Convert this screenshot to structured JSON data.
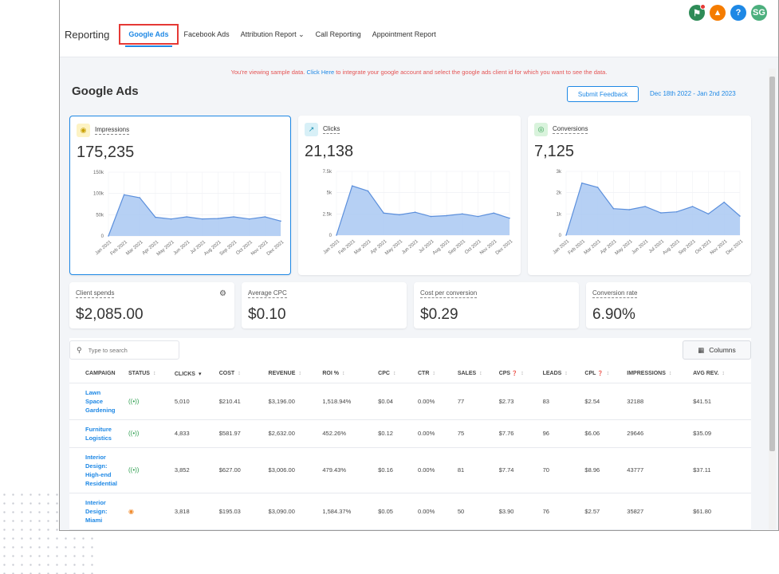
{
  "topbar": {
    "icons": [
      {
        "name": "megaphone-icon",
        "color": "#2e8b57",
        "glyph": "⚑"
      },
      {
        "name": "bell-icon",
        "color": "#f57c00",
        "glyph": "▲"
      },
      {
        "name": "help-icon",
        "color": "#1e88e5",
        "glyph": "?"
      },
      {
        "name": "user-avatar",
        "color": "#4caf7d",
        "glyph": "SG"
      }
    ]
  },
  "nav": {
    "brand": "Reporting",
    "tabs": [
      {
        "label": "Google Ads",
        "active": true
      },
      {
        "label": "Facebook Ads"
      },
      {
        "label": "Attribution Report ⌄"
      },
      {
        "label": "Call Reporting"
      },
      {
        "label": "Appointment Report"
      }
    ]
  },
  "notice": {
    "prefix": "You're viewing sample data. ",
    "link": "Click Here",
    "suffix": " to integrate your google account and select the google ads client id for which you want to see the data."
  },
  "page": {
    "title": "Google Ads",
    "feedback_label": "Submit Feedback",
    "date_range": "Dec 18th 2022 - Jan 2nd 2023"
  },
  "metrics": [
    {
      "label": "Impressions",
      "value": "175,235",
      "icon": "eye-icon",
      "icon_glyph": "◉",
      "icon_bg": "#fdf3c4",
      "icon_color": "#c9a000",
      "chart_data": {
        "type": "area",
        "x": [
          "Jan 2021",
          "Feb 2021",
          "Mar 2021",
          "Apr 2021",
          "May 2021",
          "Jun 2021",
          "Jul 2021",
          "Aug 2021",
          "Sep 2021",
          "Oct 2021",
          "Nov 2021",
          "Dec 2021"
        ],
        "values": [
          0,
          97000,
          90000,
          44000,
          40000,
          45000,
          40000,
          41000,
          45000,
          40000,
          45000,
          35000
        ],
        "yticks": [
          "150k",
          "100k",
          "50k",
          "0"
        ],
        "ylim": [
          0,
          150000
        ]
      }
    },
    {
      "label": "Clicks",
      "value": "21,138",
      "icon": "cursor-click-icon",
      "icon_glyph": "↗",
      "icon_bg": "#d8f0f7",
      "icon_color": "#1a8fb0",
      "chart_data": {
        "type": "area",
        "x": [
          "Jan 2021",
          "Feb 2021",
          "Mar 2021",
          "Apr 2021",
          "May 2021",
          "Jun 2021",
          "Jul 2021",
          "Aug 2021",
          "Sep 2021",
          "Oct 2021",
          "Nov 2021",
          "Dec 2021"
        ],
        "values": [
          0,
          5800,
          5200,
          2600,
          2400,
          2700,
          2200,
          2300,
          2500,
          2200,
          2600,
          2000
        ],
        "yticks": [
          "7.5k",
          "5k",
          "2.5k",
          "0"
        ],
        "ylim": [
          0,
          7500
        ]
      }
    },
    {
      "label": "Conversions",
      "value": "7,125",
      "icon": "target-icon",
      "icon_glyph": "◎",
      "icon_bg": "#d9f3dc",
      "icon_color": "#2e9e4f",
      "chart_data": {
        "type": "area",
        "x": [
          "Jan 2021",
          "Feb 2021",
          "Mar 2021",
          "Apr 2021",
          "May 2021",
          "Jun 2021",
          "Jul 2021",
          "Aug 2021",
          "Sep 2021",
          "Oct 2021",
          "Nov 2021",
          "Dec 2021"
        ],
        "values": [
          0,
          2450,
          2250,
          1250,
          1200,
          1350,
          1050,
          1100,
          1350,
          1000,
          1550,
          900
        ],
        "yticks": [
          "3k",
          "2k",
          "1k",
          "0"
        ],
        "ylim": [
          0,
          3000
        ]
      }
    }
  ],
  "stats": [
    {
      "label": "Client spends",
      "value": "$2,085.00"
    },
    {
      "label": "Average CPC",
      "value": "$0.10"
    },
    {
      "label": "Cost per conversion",
      "value": "$0.29"
    },
    {
      "label": "Conversion rate",
      "value": "6.90%"
    }
  ],
  "table": {
    "search_placeholder": "Type to search",
    "columns_label": "Columns",
    "headers": [
      "CAMPAIGN",
      "STATUS",
      "CLICKS",
      "COST",
      "REVENUE",
      "ROI %",
      "CPC",
      "CTR",
      "SALES",
      "CPS",
      "LEADS",
      "CPL",
      "IMPRESSIONS",
      "AVG REV."
    ],
    "rows": [
      {
        "campaign": "Lawn Space Gardening",
        "status": "active",
        "clicks": "5,010",
        "cost": "$210.41",
        "revenue": "$3,196.00",
        "roi": "1,518.94%",
        "cpc": "$0.04",
        "ctr": "0.00%",
        "sales": "77",
        "cps": "$2.73",
        "leads": "83",
        "cpl": "$2.54",
        "impressions": "32188",
        "avg_rev": "$41.51"
      },
      {
        "campaign": "Furniture Logistics",
        "status": "active",
        "clicks": "4,833",
        "cost": "$581.97",
        "revenue": "$2,632.00",
        "roi": "452.26%",
        "cpc": "$0.12",
        "ctr": "0.00%",
        "sales": "75",
        "cps": "$7.76",
        "leads": "96",
        "cpl": "$6.06",
        "impressions": "29646",
        "avg_rev": "$35.09"
      },
      {
        "campaign": "Interior Design: High-end Residential",
        "status": "active",
        "clicks": "3,852",
        "cost": "$627.00",
        "revenue": "$3,006.00",
        "roi": "479.43%",
        "cpc": "$0.16",
        "ctr": "0.00%",
        "sales": "81",
        "cps": "$7.74",
        "leads": "70",
        "cpl": "$8.96",
        "impressions": "43777",
        "avg_rev": "$37.11"
      },
      {
        "campaign": "Interior Design: Miami",
        "status": "paused",
        "clicks": "3,818",
        "cost": "$195.03",
        "revenue": "$3,090.00",
        "roi": "1,584.37%",
        "cpc": "$0.05",
        "ctr": "0.00%",
        "sales": "50",
        "cps": "$3.90",
        "leads": "76",
        "cpl": "$2.57",
        "impressions": "35827",
        "avg_rev": "$61.80"
      }
    ]
  },
  "colors": {
    "accent": "#1e88e5",
    "chart_fill": "#a9c8f2",
    "chart_line": "#5b8fdc",
    "notice": "#e45353"
  }
}
